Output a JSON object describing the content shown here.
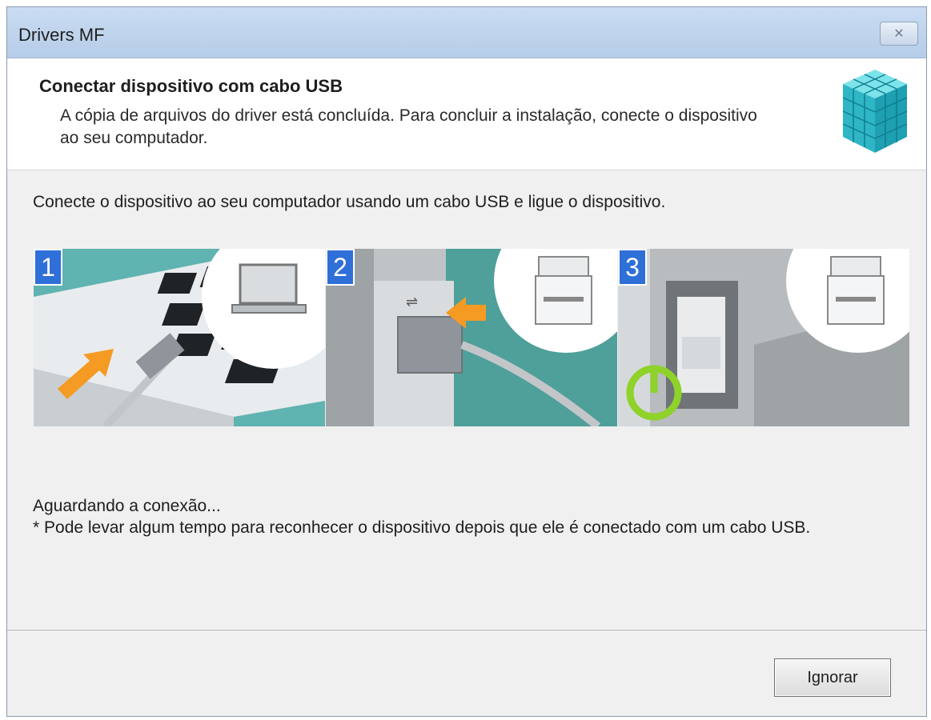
{
  "window": {
    "title": "Drivers MF"
  },
  "header": {
    "title": "Conectar dispositivo com cabo USB",
    "description": "A cópia de arquivos do driver está concluída. Para concluir a instalação, conecte o dispositivo ao seu computador."
  },
  "intro": "Conecte o dispositivo ao seu computador usando um cabo USB e ligue o dispositivo.",
  "steps": [
    {
      "number": "1",
      "icon": "laptop-usb-icon"
    },
    {
      "number": "2",
      "icon": "printer-usb-port-icon"
    },
    {
      "number": "3",
      "icon": "power-switch-icon"
    }
  ],
  "status": {
    "waiting": "Aguardando a conexão...",
    "note": "* Pode levar algum tempo para reconhecer o dispositivo depois que ele é conectado com um cabo USB."
  },
  "buttons": {
    "ignore": "Ignorar"
  },
  "colors": {
    "step_badge": "#2f6fd8",
    "arrow": "#f59a23",
    "power": "#8ed22a",
    "cube": "#3cc3d0"
  }
}
